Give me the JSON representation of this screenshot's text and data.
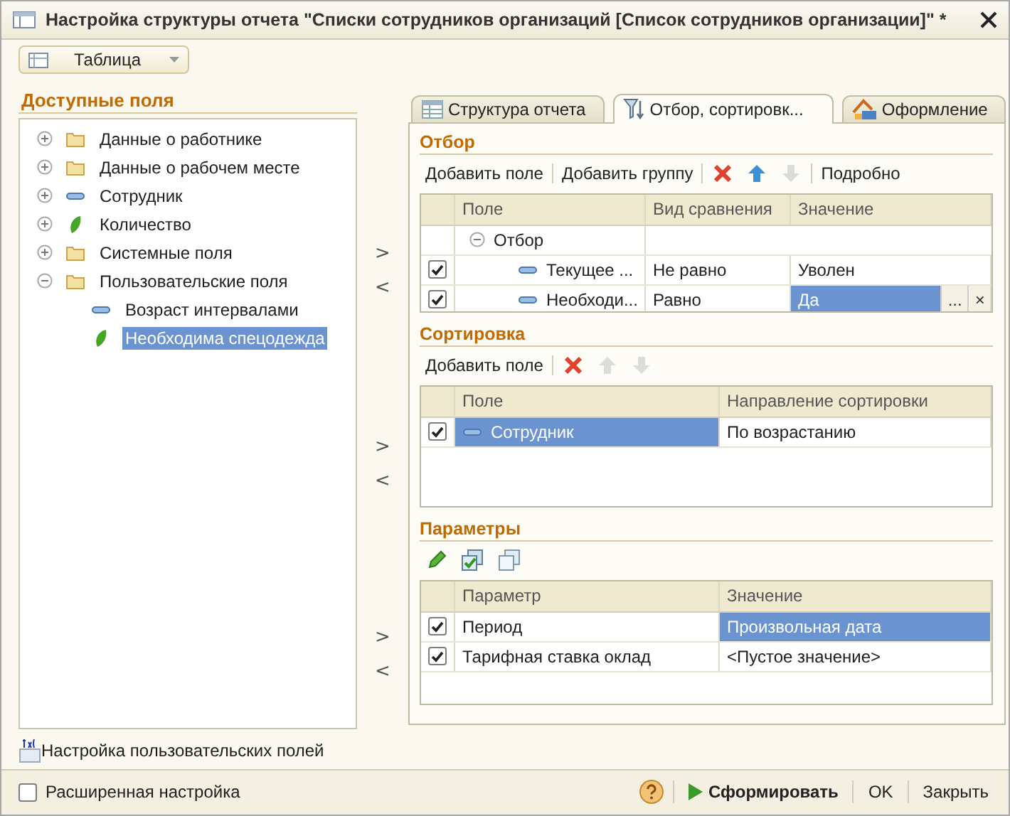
{
  "window": {
    "title": "Настройка структуры отчета \"Списки сотрудников организаций [Список сотрудников организации]\" *"
  },
  "view_selector": {
    "value": "Таблица"
  },
  "available_fields": {
    "title": "Доступные поля",
    "items": [
      {
        "label": "Данные о работнике",
        "kind": "folder",
        "expanded": false,
        "selected": false
      },
      {
        "label": "Данные о рабочем месте",
        "kind": "folder",
        "expanded": false,
        "selected": false
      },
      {
        "label": "Сотрудник",
        "kind": "attribute",
        "expanded": false,
        "selected": false
      },
      {
        "label": "Количество",
        "kind": "measure",
        "expanded": false,
        "selected": false
      },
      {
        "label": "Системные поля",
        "kind": "folder",
        "expanded": false,
        "selected": false
      },
      {
        "label": "Пользовательские поля",
        "kind": "folder",
        "expanded": true,
        "selected": false,
        "children": [
          {
            "label": "Возраст интервалами",
            "kind": "attribute",
            "selected": false
          },
          {
            "label": "Необходима спецодежда",
            "kind": "measure",
            "selected": true
          }
        ]
      }
    ]
  },
  "move_buttons": [
    {
      "add": ">",
      "remove": "<"
    },
    {
      "add": ">",
      "remove": "<"
    },
    {
      "add": ">",
      "remove": "<"
    }
  ],
  "custom_fields_link": "Настройка пользовательских полей",
  "tabs": [
    {
      "label": "Структура отчета",
      "kind": "structure",
      "selected": false
    },
    {
      "label": "Отбор, сортировк...",
      "kind": "filter",
      "selected": true
    },
    {
      "label": "Оформление",
      "kind": "appearance",
      "selected": false
    }
  ],
  "filter": {
    "title": "Отбор",
    "toolbar": [
      {
        "kind": "text",
        "label": "Добавить поле",
        "disabled": false
      },
      {
        "kind": "text",
        "label": "Добавить группу",
        "disabled": false
      },
      {
        "kind": "delete",
        "disabled": false
      },
      {
        "kind": "up",
        "disabled": false
      },
      {
        "kind": "down",
        "disabled": true
      },
      {
        "kind": "text",
        "label": "Подробно",
        "disabled": false
      }
    ],
    "columns": [
      "Поле",
      "Вид сравнения",
      "Значение"
    ],
    "rows": [
      {
        "label": "Отбор",
        "expanded": true,
        "children": [
          {
            "checked": true,
            "cells": [
              {
                "text": "Текущее ...",
                "kind": "attribute",
                "selected": false
              },
              {
                "text": "Не равно",
                "selected": false
              },
              {
                "text": "Уволен",
                "selected": false
              }
            ]
          },
          {
            "checked": true,
            "cells": [
              {
                "text": "Необходи...",
                "kind": "attribute",
                "selected": false
              },
              {
                "text": "Равно",
                "selected": false
              },
              {
                "text": "Да",
                "selected": true,
                "buttons": [
                  "...",
                  "×"
                ]
              }
            ]
          }
        ]
      }
    ]
  },
  "sorting": {
    "title": "Сортировка",
    "toolbar": [
      {
        "kind": "text",
        "label": "Добавить поле",
        "disabled": false
      },
      {
        "kind": "delete",
        "disabled": false
      },
      {
        "kind": "up",
        "disabled": true
      },
      {
        "kind": "down",
        "disabled": true
      }
    ],
    "columns": [
      "Поле",
      "Направление сортировки"
    ],
    "rows": [
      {
        "checked": true,
        "cells": [
          {
            "text": "Сотрудник",
            "kind": "attribute",
            "selected": true
          },
          {
            "text": "По возрастанию",
            "selected": false
          }
        ]
      }
    ]
  },
  "parameters": {
    "title": "Параметры",
    "toolbar": [
      {
        "kind": "edit",
        "disabled": false
      },
      {
        "kind": "check_all",
        "disabled": false
      },
      {
        "kind": "uncheck_all",
        "disabled": false
      }
    ],
    "columns": [
      "Параметр",
      "Значение"
    ],
    "rows": [
      {
        "checked": true,
        "cells": [
          {
            "text": "Период",
            "selected": false
          },
          {
            "text": "Произвольная дата",
            "selected": true
          }
        ]
      },
      {
        "checked": true,
        "cells": [
          {
            "text": "Тарифная ставка оклад",
            "selected": false
          },
          {
            "text": "<Пустое значение>",
            "selected": false
          }
        ]
      }
    ]
  },
  "footer": {
    "extended_settings": {
      "label": "Расширенная настройка",
      "checked": false
    },
    "buttons": [
      {
        "kind": "help"
      },
      {
        "kind": "primary",
        "label": "Сформировать"
      },
      {
        "kind": "plain",
        "label": "OK"
      },
      {
        "kind": "plain",
        "label": "Закрыть"
      }
    ]
  }
}
